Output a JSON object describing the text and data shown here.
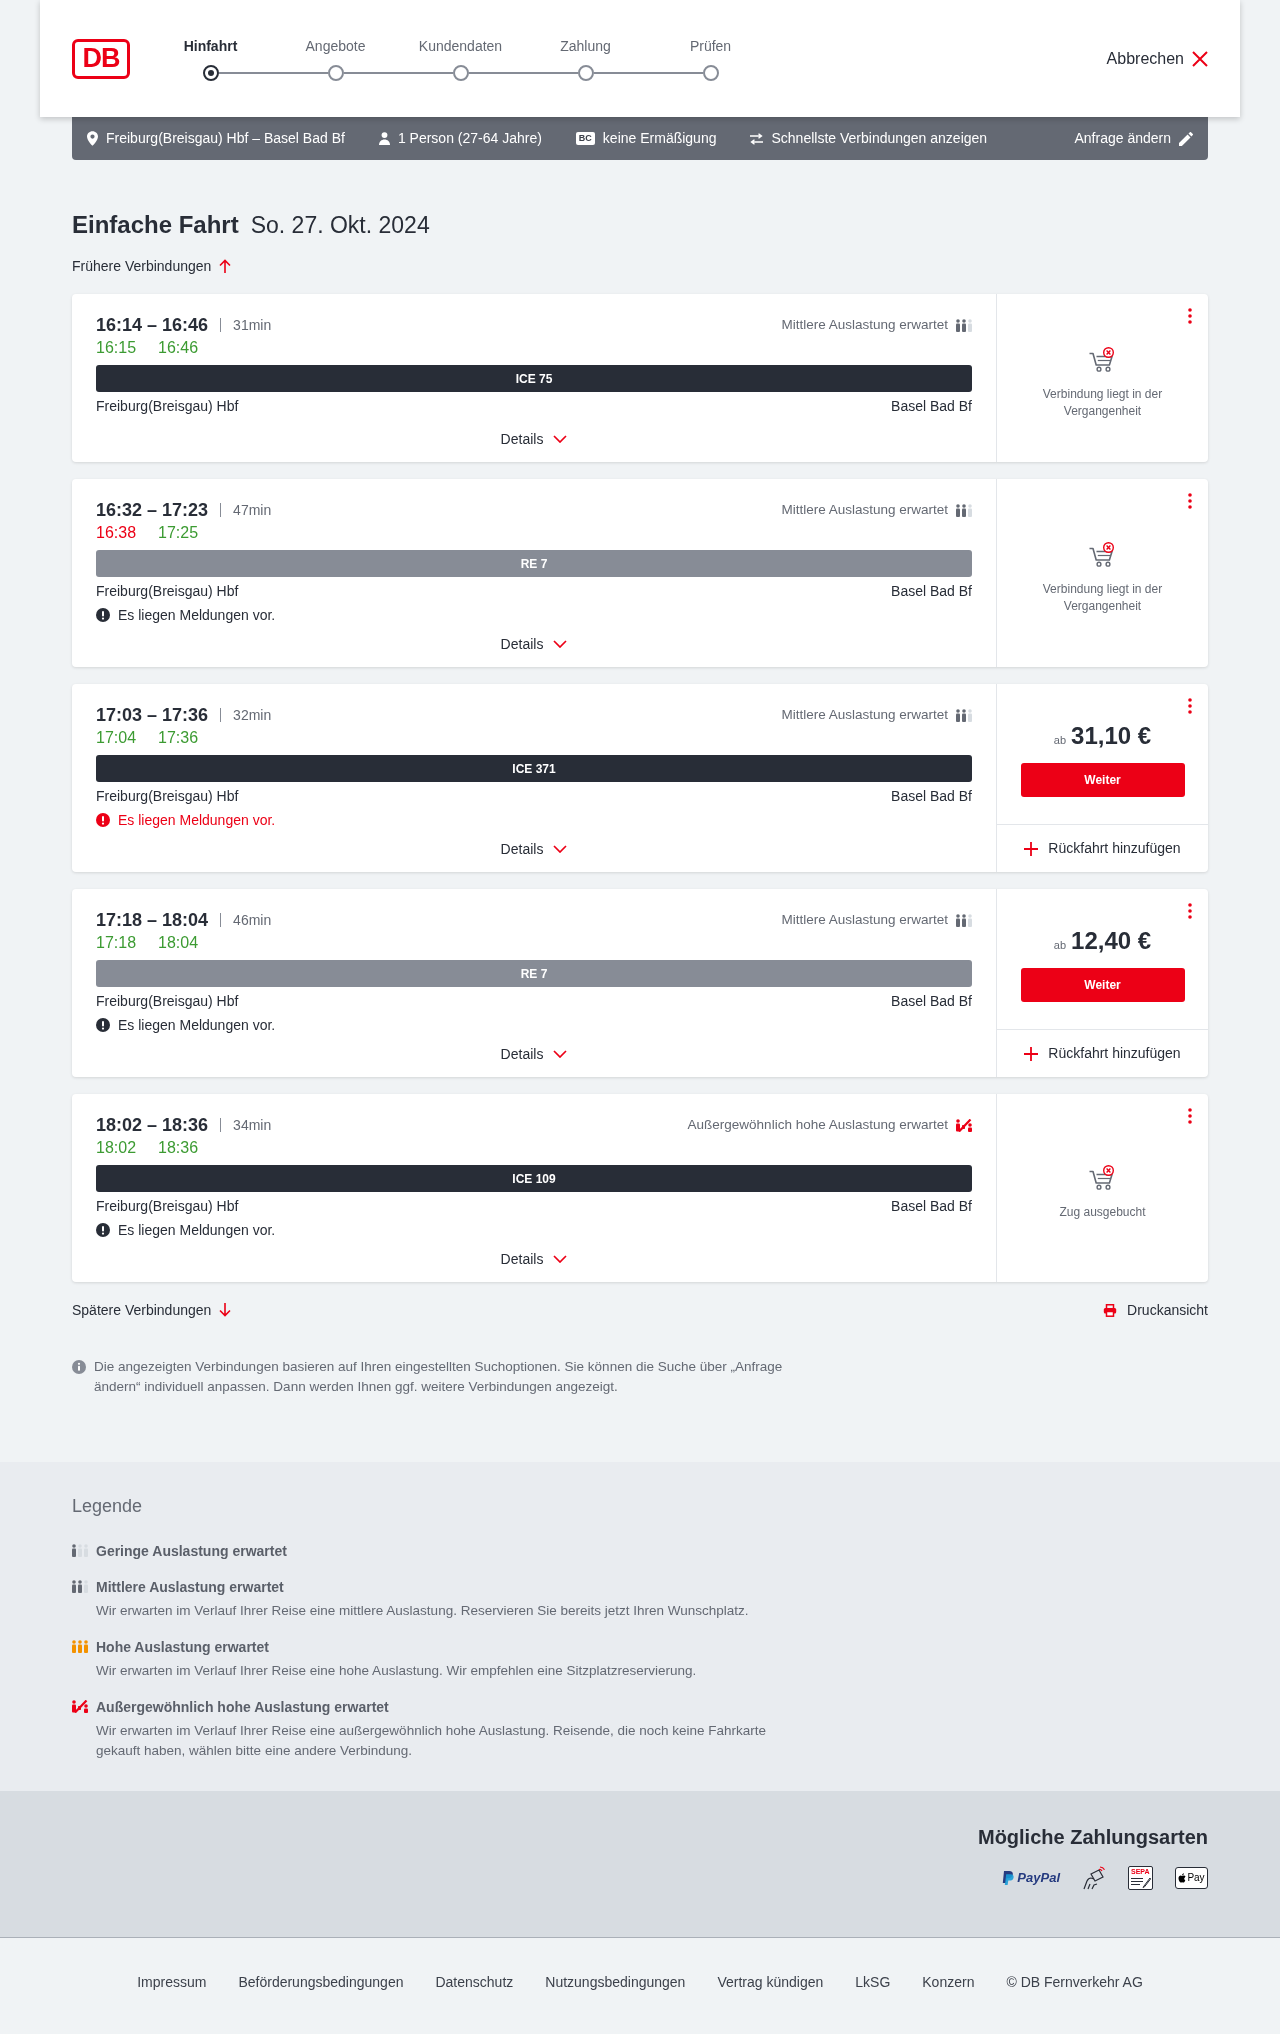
{
  "header": {
    "logo": "DB",
    "steps": [
      {
        "label": "Hinfahrt",
        "selected": true
      },
      {
        "label": "Angebote",
        "selected": false
      },
      {
        "label": "Kundendaten",
        "selected": false
      },
      {
        "label": "Zahlung",
        "selected": false
      },
      {
        "label": "Prüfen",
        "selected": false
      }
    ],
    "cancel": "Abbrechen"
  },
  "search_summary": {
    "route": "Freiburg(Breisgau) Hbf – Basel Bad Bf",
    "passengers": "1 Person (27-64 Jahre)",
    "discount_tag": "BC",
    "discount": "keine Ermäßigung",
    "option": "Schnellste Verbindungen anzeigen",
    "edit": "Anfrage ändern"
  },
  "heading": {
    "title": "Einfache Fahrt",
    "date": "So. 27. Okt. 2024"
  },
  "earlier_link": "Frühere Verbindungen",
  "connections": [
    {
      "time": "16:14 – 16:46",
      "duration": "31min",
      "realtime": [
        {
          "time": "16:15",
          "late": false
        },
        {
          "time": "16:46",
          "late": false
        }
      ],
      "occupancy": {
        "kind": "medium",
        "label": "Mittlere Auslastung erwartet"
      },
      "train": {
        "name": "ICE 75",
        "kind": "longdistance"
      },
      "from": "Freiburg(Breisgau) Hbf",
      "to": "Basel Bad Bf",
      "details": "Details",
      "offer": {
        "kind": "unavailable",
        "text": "Verbindung liegt in der Vergangenheit"
      }
    },
    {
      "time": "16:32 – 17:23",
      "duration": "47min",
      "realtime": [
        {
          "time": "16:38",
          "late": true
        },
        {
          "time": "17:25",
          "late": false
        }
      ],
      "occupancy": {
        "kind": "medium",
        "label": "Mittlere Auslastung erwartet"
      },
      "train": {
        "name": "RE 7",
        "kind": "regional"
      },
      "from": "Freiburg(Breisgau) Hbf",
      "to": "Basel Bad Bf",
      "message": {
        "text": "Es liegen Meldungen vor.",
        "critical": false
      },
      "details": "Details",
      "offer": {
        "kind": "unavailable",
        "text": "Verbindung liegt in der Vergangenheit"
      }
    },
    {
      "time": "17:03 – 17:36",
      "duration": "32min",
      "realtime": [
        {
          "time": "17:04",
          "late": false
        },
        {
          "time": "17:36",
          "late": false
        }
      ],
      "occupancy": {
        "kind": "medium",
        "label": "Mittlere Auslastung erwartet"
      },
      "train": {
        "name": "ICE 371",
        "kind": "longdistance"
      },
      "from": "Freiburg(Breisgau) Hbf",
      "to": "Basel Bad Bf",
      "message": {
        "text": "Es liegen Meldungen vor.",
        "critical": true
      },
      "details": "Details",
      "offer": {
        "kind": "bookable",
        "prefix": "ab",
        "price": "31,10 €",
        "button": "Weiter",
        "return_trip": "Rückfahrt hinzufügen"
      }
    },
    {
      "time": "17:18 – 18:04",
      "duration": "46min",
      "realtime": [
        {
          "time": "17:18",
          "late": false
        },
        {
          "time": "18:04",
          "late": false
        }
      ],
      "occupancy": {
        "kind": "medium",
        "label": "Mittlere Auslastung erwartet"
      },
      "train": {
        "name": "RE 7",
        "kind": "regional"
      },
      "from": "Freiburg(Breisgau) Hbf",
      "to": "Basel Bad Bf",
      "message": {
        "text": "Es liegen Meldungen vor.",
        "critical": false
      },
      "details": "Details",
      "offer": {
        "kind": "bookable",
        "prefix": "ab",
        "price": "12,40 €",
        "button": "Weiter",
        "return_trip": "Rückfahrt hinzufügen"
      }
    },
    {
      "time": "18:02 – 18:36",
      "duration": "34min",
      "realtime": [
        {
          "time": "18:02",
          "late": false
        },
        {
          "time": "18:36",
          "late": false
        }
      ],
      "occupancy": {
        "kind": "exceptional",
        "label": "Außergewöhnlich hohe Auslastung erwartet"
      },
      "train": {
        "name": "ICE 109",
        "kind": "longdistance"
      },
      "from": "Freiburg(Breisgau) Hbf",
      "to": "Basel Bad Bf",
      "message": {
        "text": "Es liegen Meldungen vor.",
        "critical": false
      },
      "details": "Details",
      "offer": {
        "kind": "unavailable",
        "text": "Zug ausgebucht"
      }
    }
  ],
  "later_link": "Spätere Verbindungen",
  "print_link": "Druckansicht",
  "info_note": "Die angezeigten Verbindungen basieren auf Ihren eingestellten Suchoptionen. Sie können die Suche über „Anfrage ändern“ individuell anpassen. Dann werden Ihnen ggf. weitere Verbindungen angezeigt.",
  "legend": {
    "title": "Legende",
    "items": [
      {
        "kind": "low",
        "title": "Geringe Auslastung erwartet"
      },
      {
        "kind": "medium",
        "title": "Mittlere Auslastung erwartet",
        "description": "Wir erwarten im Verlauf Ihrer Reise eine mittlere Auslastung. Reservieren Sie bereits jetzt Ihren Wunschplatz."
      },
      {
        "kind": "high",
        "title": "Hohe Auslastung erwartet",
        "description": "Wir erwarten im Verlauf Ihrer Reise eine hohe Auslastung. Wir empfehlen eine Sitzplatzreservierung."
      },
      {
        "kind": "exceptional",
        "title": "Außergewöhnlich hohe Auslastung erwartet",
        "description": "Wir erwarten im Verlauf Ihrer Reise eine außergewöhnlich hohe Auslastung. Reisende, die noch keine Fahrkarte gekauft haben, wählen bitte eine andere Verbindung."
      }
    ]
  },
  "payment": {
    "title": "Mögliche Zahlungsarten",
    "methods": [
      {
        "kind": "paypal",
        "label": "PayPal"
      },
      {
        "kind": "contactless"
      },
      {
        "kind": "sepa",
        "label": "SEPA"
      },
      {
        "kind": "wallet",
        "label": "Pay"
      }
    ]
  },
  "footer_links": [
    "Impressum",
    "Beförderungsbedingungen",
    "Datenschutz",
    "Nutzungsbedingungen",
    "Vertrag kündigen",
    "LkSG",
    "Konzern"
  ],
  "copyright": "© DB Fernverkehr AG"
}
